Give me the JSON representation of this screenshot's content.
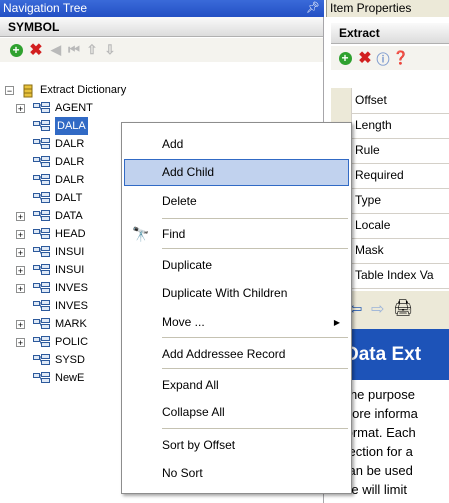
{
  "nav_panel": {
    "title": "Navigation Tree",
    "pin_icon": "pushpin-icon",
    "header": "SYMBOL"
  },
  "nav_toolbar": {
    "icons": [
      "add-icon",
      "delete-icon",
      "move-left-icon",
      "move-first-icon",
      "move-up-icon",
      "move-down-icon"
    ]
  },
  "tree": {
    "root": "Extract Dictionary",
    "items": [
      {
        "label": "AGENT",
        "expandable": true
      },
      {
        "label": "DALA",
        "selected": true
      },
      {
        "label": "DALR"
      },
      {
        "label": "DALR"
      },
      {
        "label": "DALR"
      },
      {
        "label": "DALT"
      },
      {
        "label": "DATA",
        "expandable": true
      },
      {
        "label": "HEAD",
        "expandable": true
      },
      {
        "label": "INSUI",
        "expandable": true
      },
      {
        "label": "INSUI",
        "expandable": true
      },
      {
        "label": "INVES",
        "expandable": true
      },
      {
        "label": "INVES"
      },
      {
        "label": "MARK",
        "expandable": true
      },
      {
        "label": "POLIC",
        "expandable": true
      },
      {
        "label": "SYSD"
      },
      {
        "label": "NewE"
      }
    ]
  },
  "props_panel": {
    "title": "Item Properties",
    "header": "Extract",
    "rows": [
      "Offset",
      "Length",
      "Rule",
      "Required",
      "Type",
      "Locale",
      "Mask",
      "Table Index Va"
    ],
    "help_heading": "Data Ext",
    "help_lines": [
      "The purpose",
      "store informa",
      "format. Each",
      "section for a",
      "can be used",
      "we will limit"
    ]
  },
  "context_menu": {
    "items": [
      {
        "label": "Add"
      },
      {
        "label": "Add Child",
        "highlighted": true
      },
      {
        "label": "Delete"
      },
      {
        "label": "Find",
        "icon": "binoculars-icon"
      },
      {
        "label": "Duplicate"
      },
      {
        "label": "Duplicate With Children"
      },
      {
        "label": "Move ...",
        "submenu": true
      },
      {
        "label": "Add Addressee Record"
      },
      {
        "label": "Expand All"
      },
      {
        "label": "Collapse All"
      },
      {
        "label": "Sort by Offset"
      },
      {
        "label": "No Sort"
      }
    ]
  },
  "colors": {
    "titlebar_blue": "#2350c4",
    "selection": "#316ac5",
    "menu_highlight": "#c1d2ee",
    "help_heading_bg": "#1d53b8"
  }
}
